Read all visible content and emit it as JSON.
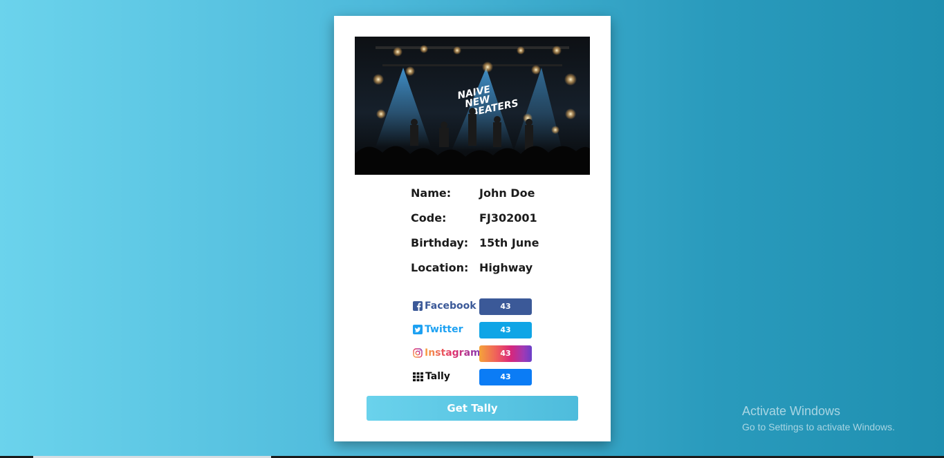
{
  "profile": {
    "image_alt": "Concert stage photo",
    "band_logo": "NAIVE NEW BEATERS",
    "fields": [
      {
        "label": "Name:",
        "value": "John Doe"
      },
      {
        "label": "Code:",
        "value": "FJ302001"
      },
      {
        "label": "Birthday:",
        "value": "15th June"
      },
      {
        "label": "Location:",
        "value": "Highway"
      }
    ]
  },
  "social": [
    {
      "name": "Facebook",
      "icon": "facebook-icon",
      "count": "43",
      "color": "#3b5998"
    },
    {
      "name": "Twitter",
      "icon": "twitter-icon",
      "count": "43",
      "color": "#1da1f2"
    },
    {
      "name": "Instagram",
      "icon": "instagram-icon",
      "count": "43",
      "color": "#c13584"
    },
    {
      "name": "Tally",
      "icon": "grid-icon",
      "count": "43",
      "color": "#007bff"
    }
  ],
  "action": {
    "label": "Get Tally"
  },
  "watermark": {
    "title": "Activate Windows",
    "subtitle": "Go to Settings to activate Windows."
  }
}
